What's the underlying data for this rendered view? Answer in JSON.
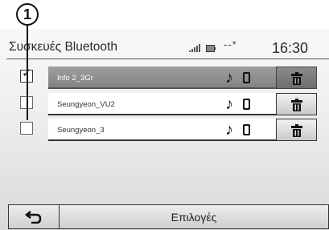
{
  "callout": {
    "label": "1"
  },
  "header": {
    "title": "Συσκευές Bluetooth",
    "bt_status": "--*",
    "clock": "16:30"
  },
  "devices": [
    {
      "name": "Info 2_3Gr",
      "selected": true
    },
    {
      "name": "Seungyeon_VU2",
      "selected": false
    },
    {
      "name": "Seungyeon_3",
      "selected": false
    }
  ],
  "icons": {
    "checkbox_mark": "✓",
    "music": "♪",
    "phone": "phone-icon",
    "delete": "trash-icon",
    "back": "back-arrow-icon"
  },
  "footer": {
    "options_label": "Επιλογές"
  }
}
